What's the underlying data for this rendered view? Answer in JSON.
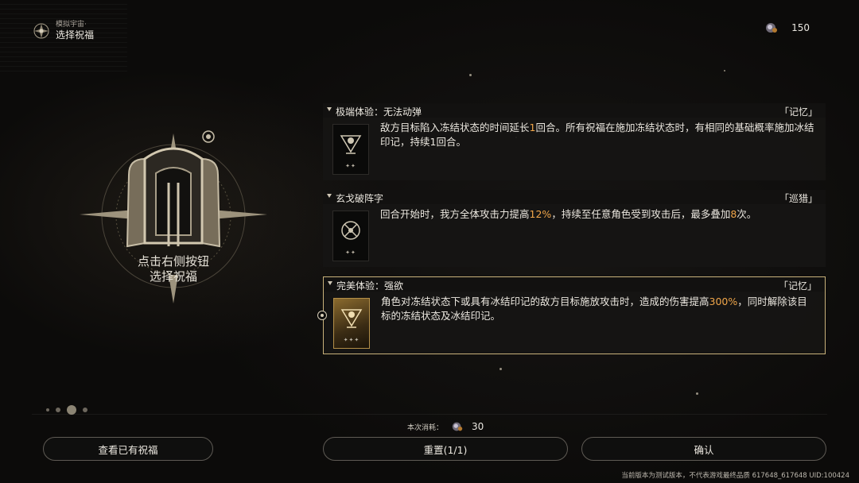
{
  "header": {
    "subtitle": "模拟宇宙·",
    "title": "选择祝福"
  },
  "currency": {
    "icon": "cosmic-fragment-icon",
    "value": "150"
  },
  "emblem": {
    "icon": "blessing-emblem-icon",
    "line1": "点击右侧按钮",
    "line2": "选择祝福"
  },
  "blessings": [
    {
      "title": "极端体验：无法动弹",
      "path": "「记忆」",
      "icon": "blessing-memory-icon",
      "desc": [
        "敌方目标陷入冻结状态的时间延长",
        "1",
        "回合。所有祝福在施加冻结状态时，有相同的基础概率施加冰结印记，持续1回合。"
      ],
      "rarity": "✦✦",
      "selected": false
    },
    {
      "title": "玄戈破阵字",
      "path": "「巡猎」",
      "icon": "blessing-hunt-icon",
      "desc": [
        "回合开始时，我方全体攻击力提高",
        "12%",
        "，持续至任意角色受到攻击后，最多叠加",
        "8",
        "次。"
      ],
      "rarity": "✦✦",
      "selected": false
    },
    {
      "title": "完美体验：强欲",
      "path": "「记忆」",
      "icon": "blessing-memory-gold-icon",
      "desc": [
        "角色对冻结状态下或具有冰结印记的敌方目标施放攻击时，造成的伤害提高",
        "300%",
        "，同时解除该目标的冻结状态及冰结印记。"
      ],
      "rarity": "✦✦✦",
      "selected": true
    }
  ],
  "cost": {
    "label": "本次消耗：",
    "icon": "cosmic-fragment-icon",
    "value": "30"
  },
  "buttons": {
    "view": "查看已有祝福",
    "reset": "重置(1/1)",
    "confirm": "确认"
  },
  "footer": "当前版本为测试版本，不代表游戏最终品质 617648_617648 UID:100424",
  "colors": {
    "highlight": "#f0a64a",
    "selected_border": "#c9b27b"
  }
}
